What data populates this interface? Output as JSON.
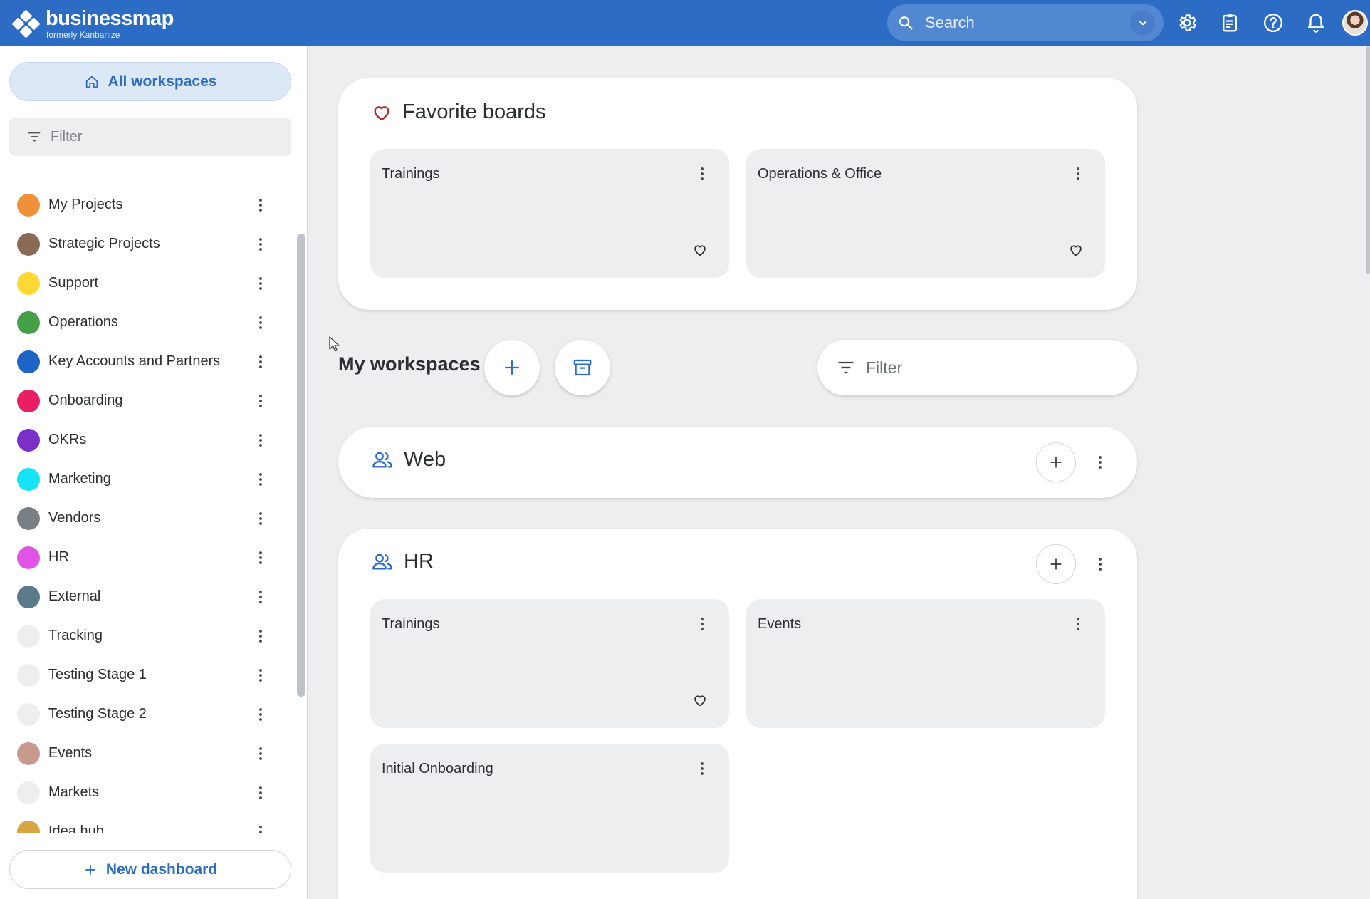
{
  "brand": {
    "name": "businessmap",
    "subtitle": "formerly Kanbanize",
    "color": "#2d6cc5"
  },
  "topbar": {
    "search_placeholder": "Search",
    "icons": [
      "search-icon",
      "chevron-down-icon",
      "settings-icon",
      "clipboard-icon",
      "help-icon",
      "bell-icon",
      "user-avatar"
    ]
  },
  "sidebar": {
    "all_workspaces_label": "All workspaces",
    "filter_placeholder": "Filter",
    "items": [
      {
        "label": "My Projects",
        "color": "#f0913a"
      },
      {
        "label": "Strategic Projects",
        "color": "#8a6a55"
      },
      {
        "label": "Support",
        "color": "#fdd835"
      },
      {
        "label": "Operations",
        "color": "#43a047"
      },
      {
        "label": "Key Accounts and Partners",
        "color": "#1e63c6"
      },
      {
        "label": "Onboarding",
        "color": "#e91e63"
      },
      {
        "label": "OKRs",
        "color": "#7b2fc9"
      },
      {
        "label": "Marketing",
        "color": "#14e4f5"
      },
      {
        "label": "Vendors",
        "color": "#7a7f86"
      },
      {
        "label": "HR",
        "color": "#e053e6"
      },
      {
        "label": "External",
        "color": "#5d7a8a"
      },
      {
        "label": "Tracking",
        "color": "#eceef0"
      },
      {
        "label": "Testing Stage 1",
        "color": "#eceef0"
      },
      {
        "label": "Testing Stage 2",
        "color": "#eceef0"
      },
      {
        "label": "Events",
        "color": "#c79a8c"
      },
      {
        "label": "Markets",
        "color": "#eceef0"
      },
      {
        "label": "Idea hub",
        "color": "#d9a441"
      }
    ],
    "new_dashboard_label": "New dashboard"
  },
  "favorites": {
    "title": "Favorite boards",
    "boards": [
      {
        "name": "Trainings"
      },
      {
        "name": "Operations & Office"
      }
    ]
  },
  "my_workspaces": {
    "title": "My workspaces",
    "filter_placeholder": "Filter",
    "workspaces": [
      {
        "name": "Web",
        "boards": []
      },
      {
        "name": "HR",
        "boards": [
          {
            "name": "Trainings",
            "favorite": true
          },
          {
            "name": "Events",
            "favorite": false
          },
          {
            "name": "Initial Onboarding",
            "favorite": false
          }
        ]
      }
    ]
  }
}
